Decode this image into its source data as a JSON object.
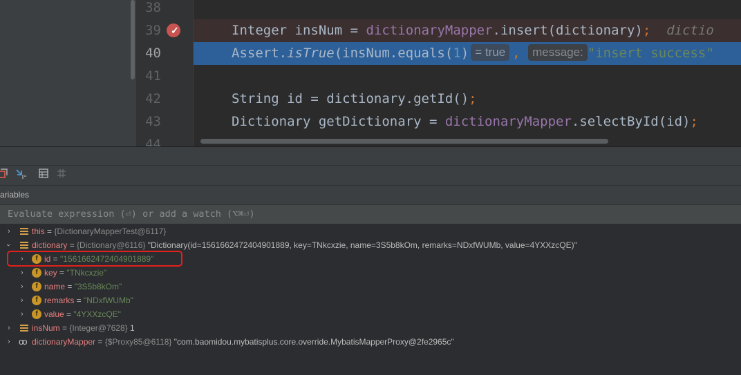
{
  "editor": {
    "line_numbers": [
      "38",
      "39",
      "40",
      "41",
      "42",
      "43",
      "44"
    ],
    "line39": {
      "type": "Integer",
      "var": "insNum",
      "eq": " = ",
      "field": "dictionaryMapper",
      "call": ".insert(dictionary)",
      "semi": ";",
      "hint": "dictio"
    },
    "line40": {
      "prefix": "Assert.",
      "method": "isTrue",
      "mid": "(insNum.equals(",
      "num": "1",
      "paren": ")",
      "inlay_value": "= true",
      "comma": ",",
      "inlay_label": "message:",
      "string": "\"insert success\""
    },
    "line42": {
      "text": "String id = dictionary.getId()",
      "semi": ";"
    },
    "line43": {
      "text": "Dictionary getDictionary = ",
      "field": "dictionaryMapper",
      "call": ".selectById(id)",
      "semi": ";"
    }
  },
  "debug": {
    "toolbar_icons": [
      "restore-layout-icon",
      "step-into-icon",
      "table-icon",
      "grid-icon"
    ],
    "variables_title": "ariables",
    "eval_placeholder": "Evaluate expression (⏎) or add a watch (⌥⌘⏎)",
    "tree": {
      "this": {
        "name": "this",
        "eq": " = ",
        "type": "{DictionaryMapperTest@6117}"
      },
      "dictionary": {
        "name": "dictionary",
        "eq": " = ",
        "type": "{Dictionary@6116}",
        "value": "\"Dictionary(id=1561662472404901889, key=TNkcxzie, name=3S5b8kOm, remarks=NDxfWUMb, value=4YXXzcQE)\"",
        "fields": [
          {
            "name": "id",
            "eq": " = ",
            "value": "\"1561662472404901889\""
          },
          {
            "name": "key",
            "eq": " = ",
            "value": "\"TNkcxzie\""
          },
          {
            "name": "name",
            "eq": " = ",
            "value": "\"3S5b8kOm\""
          },
          {
            "name": "remarks",
            "eq": " = ",
            "value": "\"NDxfWUMb\""
          },
          {
            "name": "value",
            "eq": " = ",
            "value": "\"4YXXzcQE\""
          }
        ]
      },
      "insNum": {
        "name": "insNum",
        "eq": " = ",
        "type": "{Integer@7628}",
        "value": "1"
      },
      "dictionaryMapper": {
        "name": "dictionaryMapper",
        "eq": " = ",
        "type": "{$Proxy85@6118}",
        "value": "\"com.baomidou.mybatisplus.core.override.MybatisMapperProxy@2fe2965c\""
      }
    }
  }
}
